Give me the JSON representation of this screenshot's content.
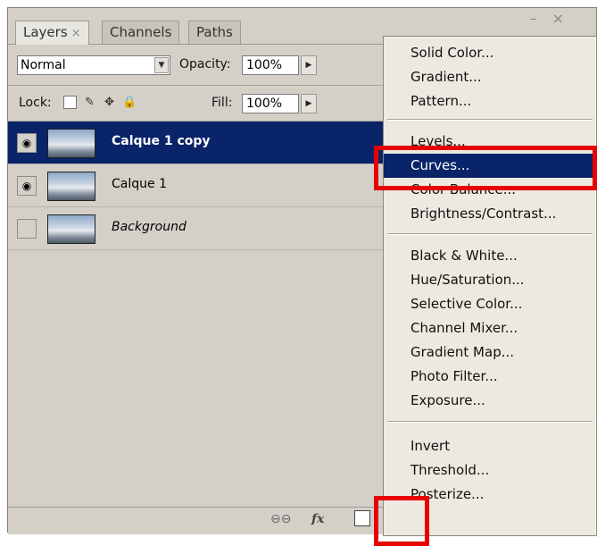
{
  "tabs": [
    {
      "label": "Layers",
      "close": "×"
    },
    {
      "label": "Channels"
    },
    {
      "label": "Paths"
    }
  ],
  "window_controls": "– ×",
  "blend_mode": "Normal",
  "opacity": {
    "label": "Opacity:",
    "value": "100%"
  },
  "lock": {
    "label": "Lock:"
  },
  "fill": {
    "label": "Fill:",
    "value": "100%"
  },
  "layers": [
    {
      "name": "Calque 1 copy",
      "visible": true,
      "selected": true
    },
    {
      "name": "Calque 1",
      "visible": true,
      "selected": false
    },
    {
      "name": "Background",
      "visible": false,
      "selected": false
    }
  ],
  "bottom_icons": [
    "link-icon",
    "fx-icon",
    "mask-icon",
    "adjustment-layer-icon",
    "group-icon",
    "new-layer-icon",
    "trash-icon"
  ],
  "bottom_text": {
    "link": "⊖⊖",
    "fx": "fx",
    "caret": "˯"
  },
  "menu": {
    "groups": [
      [
        "Solid Color...",
        "Gradient...",
        "Pattern..."
      ],
      [
        "Levels...",
        "Curves...",
        "Color Balance...",
        "Brightness/Contrast..."
      ],
      [
        "Black & White...",
        "Hue/Saturation...",
        "Selective Color...",
        "Channel Mixer...",
        "Gradient Map...",
        "Photo Filter...",
        "Exposure..."
      ],
      [
        "Invert",
        "Threshold...",
        "Posterize..."
      ]
    ],
    "highlighted": "Curves..."
  },
  "colors": {
    "selection": "#0a246a",
    "annotation": "#e60000",
    "panel": "#d4d0c8"
  }
}
